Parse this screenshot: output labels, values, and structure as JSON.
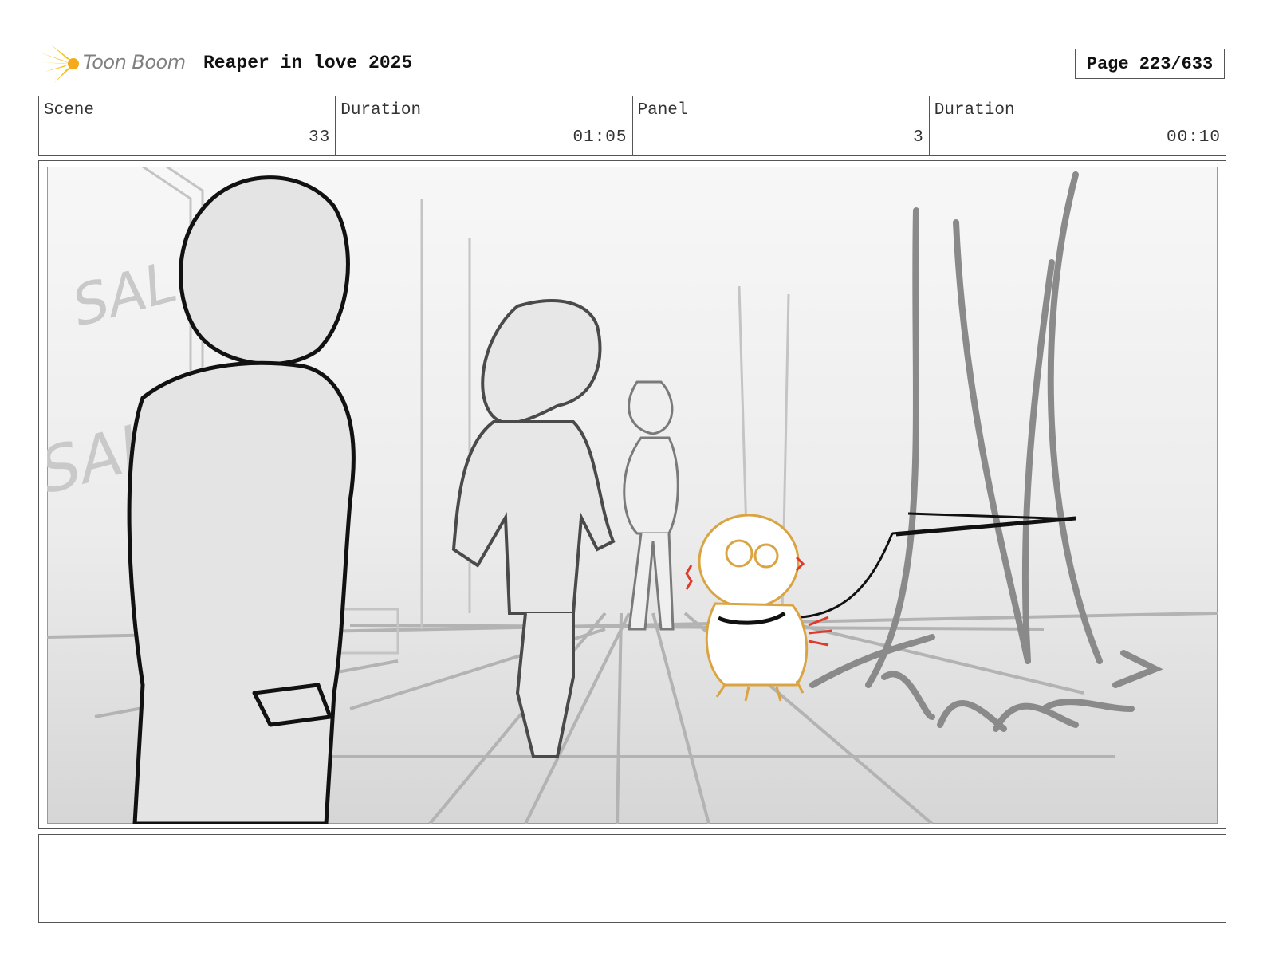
{
  "header": {
    "brand": "Toon Boom",
    "project_title": "Reaper in love 2025",
    "page_label": "Page 223/633"
  },
  "info": {
    "scene_label": "Scene",
    "scene_value": "33",
    "scene_duration_label": "Duration",
    "scene_duration_value": "01:05",
    "panel_label": "Panel",
    "panel_value": "3",
    "panel_duration_label": "Duration",
    "panel_duration_value": "00:10"
  },
  "panel_art": {
    "sign_texts": [
      "SALE",
      "SALE"
    ],
    "colors": {
      "line": "#111111",
      "sketch": "#9a9a9a",
      "dog": "#d9a441",
      "accent": "#e03a2a"
    }
  },
  "notes": {
    "text": ""
  }
}
